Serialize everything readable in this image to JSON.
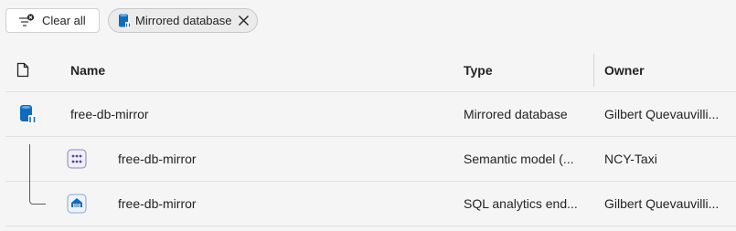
{
  "filters": {
    "clear_all_label": "Clear all",
    "active_chip_label": "Mirrored database"
  },
  "table": {
    "headers": {
      "name": "Name",
      "type": "Type",
      "owner": "Owner"
    },
    "rows": [
      {
        "name": "free-db-mirror",
        "type": "Mirrored database",
        "owner": "Gilbert Quevauvilli...",
        "icon": "mirrored-database-icon",
        "level": 0
      },
      {
        "name": "free-db-mirror",
        "type": "Semantic model (...",
        "owner": "NCY-Taxi",
        "icon": "semantic-model-icon",
        "level": 1
      },
      {
        "name": "free-db-mirror",
        "type": "SQL analytics end...",
        "owner": "Gilbert Quevauvilli...",
        "icon": "sql-analytics-endpoint-icon",
        "level": 1
      }
    ]
  },
  "colors": {
    "accent_blue": "#0f6cbd",
    "background": "#f5f5f5",
    "row_border": "#e0e0e0"
  }
}
